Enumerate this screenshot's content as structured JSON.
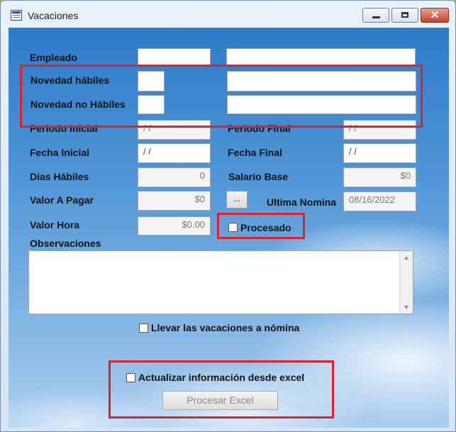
{
  "window": {
    "title": "Vacaciones",
    "close_glyph": "✕"
  },
  "form": {
    "empleado_label": "Empleado",
    "novedad_habiles_label": "Novedad hábiles",
    "novedad_no_habiles_label": "Novedad no Hábiles",
    "periodo_inicial_label": "Periodo Inicial",
    "periodo_inicial_value": "/ /",
    "periodo_final_label": "Periodo Final",
    "periodo_final_value": "/ /",
    "fecha_inicial_label": "Fecha Inicial",
    "fecha_inicial_value": "/ /",
    "fecha_final_label": "Fecha Final",
    "fecha_final_value": "/ /",
    "dias_habiles_label": "Dias Hábiles",
    "dias_habiles_value": "0",
    "salario_base_label": "Salario Base",
    "salario_base_value": "$0",
    "valor_pagar_label": "Valor A Pagar",
    "valor_pagar_value": "$0",
    "ellipsis_label": "...",
    "ultima_nomina_label": "Ultima Nomina",
    "ultima_nomina_value": "08/16/2022",
    "valor_hora_label": "Valor Hora",
    "valor_hora_value": "$0.00",
    "procesado_label": "Procesado",
    "observaciones_label": "Observaciones",
    "llevar_label": "Llevar las vacaciones a nómina",
    "actualizar_label": "Actualizar información desde excel",
    "procesar_button": "Procesar Excel"
  },
  "colors": {
    "highlight": "#e0202a"
  }
}
